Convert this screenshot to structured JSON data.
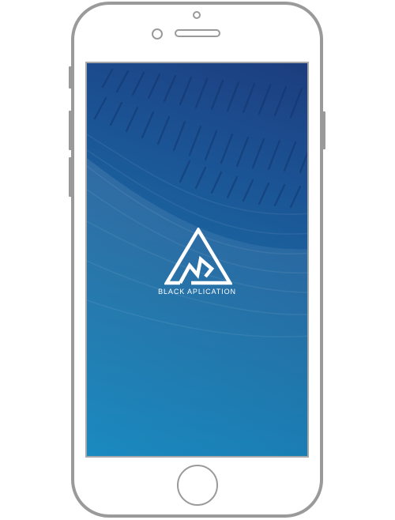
{
  "device": {
    "frame_color": "#9a9a9a",
    "screen_gradient": [
      "#1c3d7e",
      "#1b5596",
      "#1a6fa6",
      "#1a8ac0"
    ]
  },
  "splash": {
    "logo_icon": "triangle-monogram-icon",
    "brand_name": "BLACK APLICATION",
    "text_color": "#ffffff"
  }
}
